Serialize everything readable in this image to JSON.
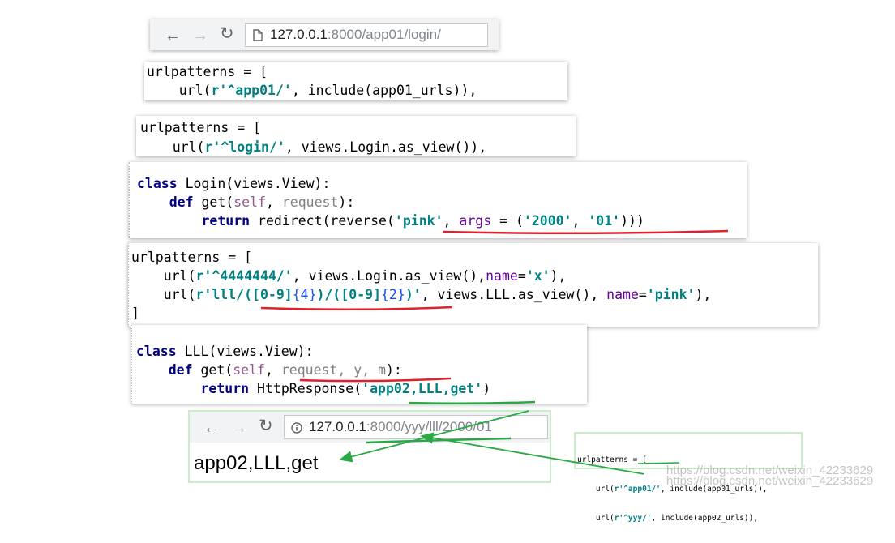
{
  "browser_top": {
    "back_icon": "arrow-left-icon",
    "forward_icon": "arrow-right-icon",
    "reload_icon": "reload-icon",
    "page_icon": "page-icon",
    "url_host": "127.0.0.1",
    "url_rest": ":8000/app01/login/"
  },
  "snippet_root_urls": {
    "line1": "urlpatterns = [",
    "l2_prefix": "    url(",
    "l2_str": "r'^app01/'",
    "l2_suffix": ", include(app01_urls)),"
  },
  "snippet_app01_urls": {
    "line1": "urlpatterns = [",
    "l2_prefix": "    url(",
    "l2_str": "r'^login/'",
    "l2_suffix": ", views.Login.as_view()),"
  },
  "snippet_login_view": {
    "l1_kw": "class",
    "l1_rest": " Login(views.View):",
    "l2_indent": "    ",
    "l2_kw": "def",
    "l2_name": " get(",
    "l2_self": "self",
    "l2_sep": ", ",
    "l2_param": "request",
    "l2_end": "):",
    "l3_indent": "        ",
    "l3_kw": "return",
    "l3_call": " redirect(reverse(",
    "l3_str1": "'pink'",
    "l3_sep": ", ",
    "l3_kwarg": "args",
    "l3_eq": " = (",
    "l3_str2": "'2000'",
    "l3_sep2": ", ",
    "l3_str3": "'01'",
    "l3_end": ")))"
  },
  "snippet_named_urls": {
    "line1": "urlpatterns = [",
    "l2_prefix": "    url(",
    "l2_str": "r'^4444444/'",
    "l2_mid": ", views.Login.as_view(),",
    "l2_kwarg": "name",
    "l2_eq": "=",
    "l2_name": "'x'",
    "l2_end": "),",
    "l3_prefix": "    url(",
    "l3_str_a": "r'lll/(",
    "l3_re1": "[0-9]",
    "l3_q1": "{4}",
    "l3_str_b": ")/(",
    "l3_re2": "[0-9]",
    "l3_q2": "{2}",
    "l3_str_c": ")'",
    "l3_mid": ", views.LLL.as_view(), ",
    "l3_kwarg": "name",
    "l3_eq": "=",
    "l3_name": "'pink'",
    "l3_end": "),",
    "line4": "]"
  },
  "snippet_lll_view": {
    "l1_kw": "class",
    "l1_rest": " LLL(views.View):",
    "l2_indent": "    ",
    "l2_kw": "def",
    "l2_name": " get(",
    "l2_self": "self",
    "l2_sep": ", ",
    "l2_params": "request, y, m",
    "l2_end": "):",
    "l3_indent": "        ",
    "l3_kw": "return",
    "l3_call": " HttpResponse(",
    "l3_str": "'app02,LLL,get'",
    "l3_end": ")"
  },
  "browser_bottom": {
    "back_icon": "arrow-left-icon",
    "forward_icon": "arrow-right-icon",
    "reload_icon": "reload-icon",
    "info_icon": "info-icon",
    "url_host": "127.0.0.1",
    "url_rest": ":8000/yyy/lll/2000/01",
    "page_body": "app02,LLL,get"
  },
  "snippet_root_urls_small": {
    "line1": "urlpatterns = [",
    "l2_prefix": "    url(",
    "l2_str": "r'^app01/'",
    "l2_suffix": ", include(app01_urls)),",
    "l3_prefix": "    url(",
    "l3_str": "r'^yyy/'",
    "l3_suffix": ", include(app02_urls)),"
  },
  "watermark": {
    "line1": "https://blog.csdn.net/weixin_42233629",
    "line2": "https://blog.csdn.net/weixin_42233629"
  },
  "colors": {
    "underline_red": "#e0202a",
    "arrow_green": "#2aa845",
    "panel_green_border": "#c9ecc9"
  }
}
